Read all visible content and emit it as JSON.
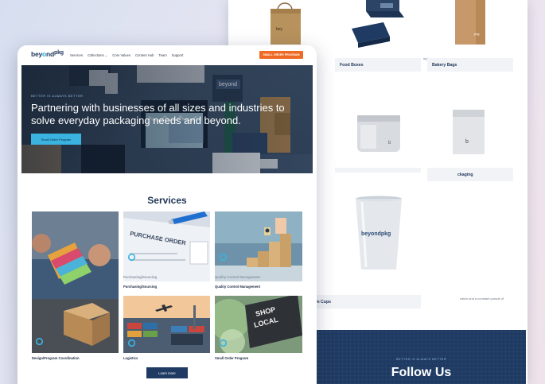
{
  "back_page": {
    "products": [
      {
        "label": "Food Boxes"
      },
      {
        "label": "Bakery Bags"
      },
      {
        "label": "ckaging"
      },
      {
        "label": "m Cups"
      }
    ],
    "cup_print": "beyondpkg",
    "faint_texts": [
      "ng )",
      "ration and a constant pursuit of"
    ],
    "follow": {
      "tagline": "BETTER IS ALWAYS BETTER",
      "title": "Follow Us"
    }
  },
  "front_page": {
    "logo": {
      "part1": "bey",
      "part2": "o",
      "part3": "nd",
      "part4": "pkg"
    },
    "nav": {
      "items": [
        "Services",
        "Collections",
        "Core Values",
        "Content Hub",
        "Team",
        "Support"
      ],
      "collections_chevron": "⌄",
      "cta": "SMALL ORDER PROGRAM"
    },
    "hero": {
      "tagline": "BETTER IS ALWAYS BETTER",
      "title": "Partnering with businesses of all sizes and industries to solve everyday packaging needs and beyond.",
      "button": "Small Order Program",
      "box_print": "beyond"
    },
    "services": {
      "title": "Services",
      "cards": [
        {
          "caption": "Design/Program Coordination",
          "icon": "ring-icon"
        },
        {
          "caption": "Purchasing/Sourcing",
          "overlay": "Purchasing/Sourcing",
          "photo_text": "PURCHASE ORDER",
          "icon": "ring-icon"
        },
        {
          "caption": "Quality Control Management",
          "overlay": "Quality Control Management",
          "icon": "ring-icon"
        },
        {
          "caption": "Logistics",
          "icon": "ring-icon"
        },
        {
          "caption": "Small Order Program",
          "photo_text_1": "SHOP",
          "photo_text_2": "LOCAL",
          "icon": "ring-icon"
        }
      ],
      "learn_more": "Learn more"
    }
  },
  "colors": {
    "navy": "#1f3b63",
    "orange": "#ee6a25",
    "cyan": "#3ab3e0"
  }
}
